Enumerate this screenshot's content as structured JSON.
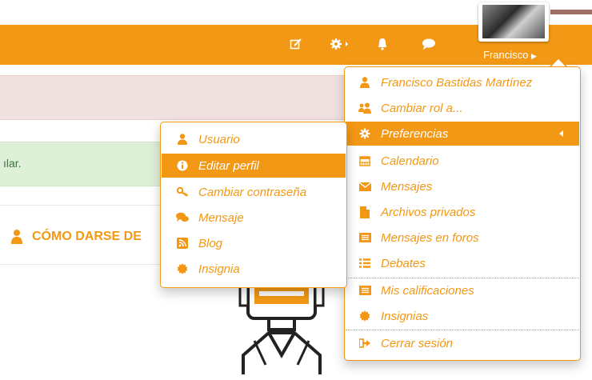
{
  "colors": {
    "accent": "#f39814",
    "navbar": "#f39814",
    "danger_bg": "#f2e1e1",
    "success_bg": "#dff0d8",
    "success_text": "#3c763d"
  },
  "navbar": {
    "user_name": "Francisco",
    "icons": [
      "edit-icon",
      "gear-icon",
      "bell-icon",
      "chat-icon"
    ]
  },
  "content": {
    "alert_success_text": "ılar.",
    "course_title": "CÓMO DARSE DE"
  },
  "user_menu": {
    "items": [
      {
        "label": "Francisco Bastidas Martínez",
        "icon": "user-icon"
      },
      {
        "label": "Cambiar rol a...",
        "icon": "users-icon"
      },
      {
        "label": "Preferencias",
        "icon": "gear-icon",
        "active": true
      },
      {
        "label": "Calendario",
        "icon": "calendar-icon"
      },
      {
        "label": "Mensajes",
        "icon": "envelope-icon"
      },
      {
        "label": "Archivos privados",
        "icon": "file-icon"
      },
      {
        "label": "Mensajes en foros",
        "icon": "list-alt-icon"
      },
      {
        "label": "Debates",
        "icon": "list-icon"
      },
      {
        "label": "Mis calificaciones",
        "icon": "table-icon"
      },
      {
        "label": "Insignias",
        "icon": "badge-icon"
      },
      {
        "label": "Cerrar sesión",
        "icon": "sign-out-icon"
      }
    ]
  },
  "preferences_menu": {
    "items": [
      {
        "label": "Usuario",
        "icon": "user-icon"
      },
      {
        "label": "Editar perfil",
        "icon": "info-icon",
        "active": true
      },
      {
        "label": "Cambiar contraseña",
        "icon": "key-icon"
      },
      {
        "label": "Mensaje",
        "icon": "comments-icon"
      },
      {
        "label": "Blog",
        "icon": "rss-icon"
      },
      {
        "label": "Insignia",
        "icon": "badge-icon"
      }
    ]
  }
}
